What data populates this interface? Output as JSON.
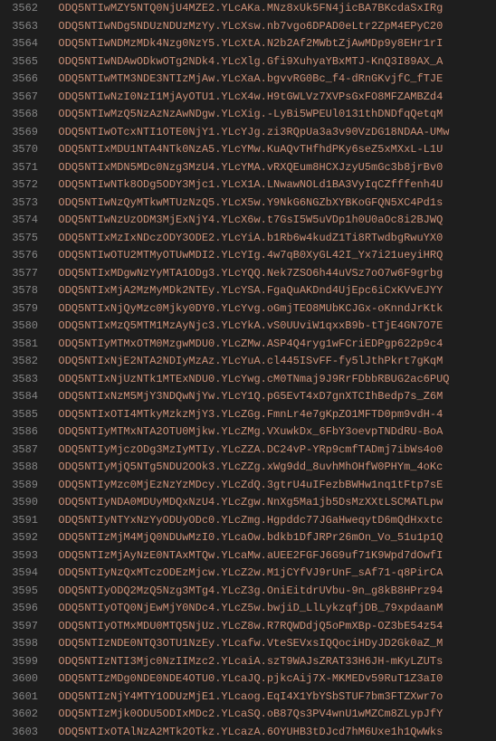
{
  "editor": {
    "firstLine": 3562,
    "lines": [
      "ODQ5NTIwMZY5NTQ0NjU4MZE2.YLcAKa.MNz8xUk5FN4jicBA7BKcdaSxIRg",
      "ODQ5NTIwNDg5NDUzNDUzMzYy.YLcXsw.nb7vgo6DPAD0eLtr2ZpM4EPyC20",
      "ODQ5NTIwNDMzMDk4Nzg0NzY5.YLcXtA.N2b2Af2MWbtZjAwMDp9y8EHr1rI",
      "ODQ5NTIwNDAwODkwOTg2NDk4.YLcXlg.Gfi9XuhyaYBxMTJ-KnQ3I89AX_A",
      "ODQ5NTIwMTM3NDE3NTIzMjAw.YLcXaA.bgvvRG0Bc_f4-dRnGKvjfC_fTJE",
      "ODQ5NTIwNzI0NzI1MjAyOTU1.YLcX4w.H9tGWLVz7XVPsGxFO8MFZAMBZd4",
      "ODQ5NTIwMzQ5NzAzNzAwNDgw.YLcXig.-LyBi5WPEUl0131thDNDfqQetqM",
      "ODQ5NTIwOTcxNTI1OTE0NjY1.YLcYJg.zi3RQpUa3a3v90VzDG18NDAA-UMw",
      "ODQ5NTIxMDU1NTA4NTk0NzA5.YLcYMw.KuAQvTHfhdPKy6seZ5xMXxL-L1U",
      "ODQ5NTIxMDN5MDc0Nzg3MzU4.YLcYMA.vRXQEum8HCXJzyU5mGc3b8jrBv0",
      "ODQ5NTIwNTk8ODg5ODY3Mjc1.YLcX1A.LNwawNOLd1BA3VyIqCZfffenh4U",
      "ODQ5NTIwNzQyMTkwMTUzNzQ5.YLcX5w.Y9NkG6NGZbXYBKoGFQN5XC4Pd1s",
      "ODQ5NTIwNzUzODM3MjExNjY4.YLcX6w.t7GsI5W5uVDp1h0U0aOc8i2BJWQ",
      "ODQ5NTIxMzIxNDczODY3ODE2.YLcYiA.b1Rb6w4kudZ1Ti8RTwdbgRwuYX0",
      "ODQ5NTIwOTU2MTMyOTUwMDI2.YLcYIg.4w7qB0XyGL42I_Yx7i21ueyiHRQ",
      "ODQ5NTIxMDgwNzYyMTA1ODg3.YLcYQQ.Nek7ZSO6h44uVSz7oO7w6F9grbg",
      "ODQ5NTIxMjA2MzMyMDk2NTEy.YLcYSA.FgaQuAKDnd4UjEpc6iCxKVvEJYY",
      "ODQ5NTIxNjQyMzc0Mjky0DY0.YLcYvg.oGmjTEO8MUbKCJGx-oKnndJrKtk",
      "ODQ5NTIxMzQ5MTM1MzAyNjc3.YLcYkA.vS0UUviW1qxxB9b-tTjE4GN7O7E",
      "ODQ5NTIyMTMxOTM0MzgwMDU0.YLcZMw.ASP4Q4ryg1wFCriEDPgp622p9c4",
      "ODQ5NTIxNjE2NTA2NDIyMzAz.YLcYuA.cl445ISvFF-fy5lJthPkrt7gKqM",
      "ODQ5NTIxNjUzNTk1MTExNDU0.YLcYwg.cM0TNmaj9J9RrFDbbRBUG2ac6PUQ",
      "ODQ5NTIxNzM5MjY3NDQwNjYw.YLcY1Q.pG5EvT4xD7gnXTCIhBedp7s_Z6M",
      "ODQ5NTIxOTI4MTkyMzkzMjY3.YLcZGg.FmnLr4e7gKpZO1MFTD0pm9vdH-4",
      "ODQ5NTIyMTMxNTA2OTU0Mjkw.YLcZMg.VXuwkDx_6FbY3oevpTNDdRU-BoA",
      "ODQ5NTIyMjczODg3MzIyMTIy.YLcZZA.DC24vP-YRp9cmfTADmj7ibWs4o0",
      "ODQ5NTIyMjQ5NTg5NDU2OOk3.YLcZZg.xWg9dd_8uvhMhOHfW0PHYm_4oKc",
      "ODQ5NTIyMzc0MjEzNzYzMDcy.YLcZdQ.3gtrU4uIFezbBWHw1nq1tFtp7sE",
      "ODQ5NTIyNDA0MDUyMDQxNzU4.YLcZgw.NnXg5Ma1jb5DsMzXXtLSCMATLpw",
      "ODQ5NTIyNTYxNzYyODUyODc0.YLcZmg.Hgpddc77JGaHweqytD6mQdHxxtc",
      "ODQ5NTIzMjM4MjQ0NDUwMzI0.YLcaOw.bdkb1DfJRPr26mOn_Vo_51u1p1Q",
      "ODQ5NTIzMjAyNzE0NTAxMTQw.YLcaMw.aUEE2FGFJ6G9uf71K9Wpd7dOwfI",
      "ODQ5NTIyNzQxMTczODEzMjcw.YLcZ2w.M1jCYfVJ9rUnF_sAf71-q8PirCA",
      "ODQ5NTIyODQ2MzQ5Nzg3MTg4.YLcZ3g.OniEitdrUVbu-9n_g8kB8HPrz94",
      "ODQ5NTIyOTQ0NjEwMjY0NDc4.YLcZ5w.bwjiD_LlLykzqfjDB_79xpdaanM",
      "ODQ5NTIyOTMxMDU0MTQ5NjUz.YLcZ8w.R7RQWDdjQ5oPmXBp-OZ3bE54z54",
      "ODQ5NTIzNDE0NTQ3OTU1NzEy.YLcafw.VteSEVxsIQQociHDyJD2Gk0aZ_M",
      "ODQ5NTIzNTI3Mjc0NzIIMzc2.YLcaiA.szT9WAJsZRAT33H6JH-mKyLZUTs",
      "ODQ5NTIzMDg0NDE0NDE4OTU0.YLcaJQ.pjkcAij7X-MKMEDv59RuT1Z3aI0",
      "ODQ5NTIzNjY4MTY1ODUzMjE1.YLcaog.EqI4X1YbYSbSTUF7bm3FTZXwr7o",
      "ODQ5NTIzMjk0ODU5ODIxMDc2.YLcaSQ.oB87Qs3PV4wnU1wMZCm8ZLypJfY",
      "ODQ5NTIxOTAlNzA2MTk2OTkz.YLcazA.6OYUHB3tDJcd7hM6Uxe1h1QwWks"
    ]
  }
}
